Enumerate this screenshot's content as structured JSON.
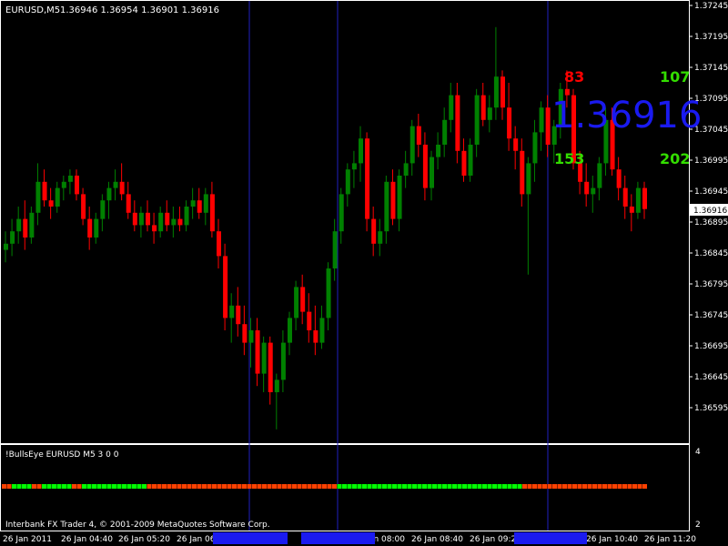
{
  "chart_data": {
    "type": "candlestick",
    "symbol_label": "EURUSD,M5",
    "ohlc_label": "1.36946 1.36954 1.36901 1.36916",
    "current_price": "1.36916",
    "big_price": "1.36916",
    "counters": {
      "top_red": "83",
      "top_green": "107",
      "bottom_left_green": "153",
      "bottom_right_green": "202"
    },
    "y_ticks": [
      "1.37245",
      "1.37195",
      "1.37145",
      "1.37095",
      "1.37045",
      "1.36995",
      "1.36945",
      "1.36895",
      "1.36845",
      "1.36795",
      "1.36745",
      "1.36695",
      "1.36645",
      "1.36595"
    ],
    "ylim": [
      1.3657,
      1.3726
    ],
    "x_ticks": [
      "26 Jan 2011",
      "26 Jan 04:40",
      "26 Jan 05:20",
      "26 Jan 06",
      "26 Jan 08:00",
      "26 Jan 08:40",
      "26 Jan 09:2",
      "26 Jan 10:40",
      "26 Jan 11:20"
    ],
    "candles": [
      {
        "o": 1.3685,
        "h": 1.3688,
        "l": 1.3683,
        "c": 1.3686
      },
      {
        "o": 1.3686,
        "h": 1.369,
        "l": 1.3684,
        "c": 1.3688
      },
      {
        "o": 1.3688,
        "h": 1.3692,
        "l": 1.3686,
        "c": 1.369
      },
      {
        "o": 1.369,
        "h": 1.3693,
        "l": 1.3685,
        "c": 1.3687
      },
      {
        "o": 1.3687,
        "h": 1.3692,
        "l": 1.3686,
        "c": 1.3691
      },
      {
        "o": 1.3691,
        "h": 1.3699,
        "l": 1.3689,
        "c": 1.3696
      },
      {
        "o": 1.3696,
        "h": 1.3698,
        "l": 1.3692,
        "c": 1.3693
      },
      {
        "o": 1.3693,
        "h": 1.3695,
        "l": 1.369,
        "c": 1.3692
      },
      {
        "o": 1.3692,
        "h": 1.3696,
        "l": 1.3691,
        "c": 1.3695
      },
      {
        "o": 1.3695,
        "h": 1.3697,
        "l": 1.3693,
        "c": 1.3696
      },
      {
        "o": 1.3696,
        "h": 1.3698,
        "l": 1.3694,
        "c": 1.3697
      },
      {
        "o": 1.3697,
        "h": 1.3698,
        "l": 1.3693,
        "c": 1.3694
      },
      {
        "o": 1.3694,
        "h": 1.3695,
        "l": 1.3689,
        "c": 1.369
      },
      {
        "o": 1.369,
        "h": 1.3692,
        "l": 1.3685,
        "c": 1.3687
      },
      {
        "o": 1.3687,
        "h": 1.3691,
        "l": 1.3686,
        "c": 1.369
      },
      {
        "o": 1.369,
        "h": 1.3694,
        "l": 1.3688,
        "c": 1.3693
      },
      {
        "o": 1.3693,
        "h": 1.3696,
        "l": 1.369,
        "c": 1.3695
      },
      {
        "o": 1.3695,
        "h": 1.3698,
        "l": 1.3693,
        "c": 1.3696
      },
      {
        "o": 1.3696,
        "h": 1.3699,
        "l": 1.3693,
        "c": 1.3694
      },
      {
        "o": 1.3694,
        "h": 1.3696,
        "l": 1.369,
        "c": 1.3691
      },
      {
        "o": 1.3691,
        "h": 1.3693,
        "l": 1.3688,
        "c": 1.3689
      },
      {
        "o": 1.3689,
        "h": 1.3692,
        "l": 1.3687,
        "c": 1.3691
      },
      {
        "o": 1.3691,
        "h": 1.3693,
        "l": 1.3688,
        "c": 1.3689
      },
      {
        "o": 1.3689,
        "h": 1.3691,
        "l": 1.3686,
        "c": 1.3688
      },
      {
        "o": 1.3688,
        "h": 1.3692,
        "l": 1.3687,
        "c": 1.3691
      },
      {
        "o": 1.3691,
        "h": 1.3693,
        "l": 1.3688,
        "c": 1.3689
      },
      {
        "o": 1.3689,
        "h": 1.3692,
        "l": 1.3687,
        "c": 1.369
      },
      {
        "o": 1.369,
        "h": 1.3692,
        "l": 1.3688,
        "c": 1.3689
      },
      {
        "o": 1.3689,
        "h": 1.3693,
        "l": 1.3688,
        "c": 1.3692
      },
      {
        "o": 1.3692,
        "h": 1.3695,
        "l": 1.369,
        "c": 1.3693
      },
      {
        "o": 1.3693,
        "h": 1.3695,
        "l": 1.369,
        "c": 1.3691
      },
      {
        "o": 1.3691,
        "h": 1.3695,
        "l": 1.3689,
        "c": 1.3694
      },
      {
        "o": 1.3694,
        "h": 1.3696,
        "l": 1.3687,
        "c": 1.3688
      },
      {
        "o": 1.3688,
        "h": 1.369,
        "l": 1.3682,
        "c": 1.3684
      },
      {
        "o": 1.3684,
        "h": 1.3686,
        "l": 1.3672,
        "c": 1.3674
      },
      {
        "o": 1.3674,
        "h": 1.3678,
        "l": 1.367,
        "c": 1.3676
      },
      {
        "o": 1.3676,
        "h": 1.3679,
        "l": 1.3671,
        "c": 1.3673
      },
      {
        "o": 1.3673,
        "h": 1.3676,
        "l": 1.3668,
        "c": 1.367
      },
      {
        "o": 1.367,
        "h": 1.3674,
        "l": 1.3666,
        "c": 1.3672
      },
      {
        "o": 1.3672,
        "h": 1.3674,
        "l": 1.3663,
        "c": 1.3665
      },
      {
        "o": 1.3665,
        "h": 1.3671,
        "l": 1.3662,
        "c": 1.367
      },
      {
        "o": 1.367,
        "h": 1.3671,
        "l": 1.366,
        "c": 1.3662
      },
      {
        "o": 1.3662,
        "h": 1.3665,
        "l": 1.3656,
        "c": 1.3664
      },
      {
        "o": 1.3664,
        "h": 1.3672,
        "l": 1.3662,
        "c": 1.367
      },
      {
        "o": 1.367,
        "h": 1.3675,
        "l": 1.3668,
        "c": 1.3674
      },
      {
        "o": 1.3674,
        "h": 1.368,
        "l": 1.3672,
        "c": 1.3679
      },
      {
        "o": 1.3679,
        "h": 1.3681,
        "l": 1.3673,
        "c": 1.3675
      },
      {
        "o": 1.3675,
        "h": 1.3678,
        "l": 1.367,
        "c": 1.3672
      },
      {
        "o": 1.3672,
        "h": 1.3676,
        "l": 1.3668,
        "c": 1.367
      },
      {
        "o": 1.367,
        "h": 1.3676,
        "l": 1.3669,
        "c": 1.3674
      },
      {
        "o": 1.3674,
        "h": 1.3683,
        "l": 1.3672,
        "c": 1.3682
      },
      {
        "o": 1.3682,
        "h": 1.369,
        "l": 1.368,
        "c": 1.3688
      },
      {
        "o": 1.3688,
        "h": 1.3695,
        "l": 1.3686,
        "c": 1.3694
      },
      {
        "o": 1.3694,
        "h": 1.3699,
        "l": 1.3692,
        "c": 1.3698
      },
      {
        "o": 1.3698,
        "h": 1.3701,
        "l": 1.3695,
        "c": 1.3699
      },
      {
        "o": 1.3699,
        "h": 1.3705,
        "l": 1.3696,
        "c": 1.3703
      },
      {
        "o": 1.3703,
        "h": 1.3704,
        "l": 1.3688,
        "c": 1.369
      },
      {
        "o": 1.369,
        "h": 1.3692,
        "l": 1.3684,
        "c": 1.3686
      },
      {
        "o": 1.3686,
        "h": 1.369,
        "l": 1.3684,
        "c": 1.3688
      },
      {
        "o": 1.3688,
        "h": 1.3697,
        "l": 1.3686,
        "c": 1.3696
      },
      {
        "o": 1.3696,
        "h": 1.3698,
        "l": 1.3689,
        "c": 1.369
      },
      {
        "o": 1.369,
        "h": 1.3698,
        "l": 1.3688,
        "c": 1.3697
      },
      {
        "o": 1.3697,
        "h": 1.3701,
        "l": 1.3695,
        "c": 1.3699
      },
      {
        "o": 1.3699,
        "h": 1.3706,
        "l": 1.3697,
        "c": 1.3705
      },
      {
        "o": 1.3705,
        "h": 1.3707,
        "l": 1.37,
        "c": 1.3702
      },
      {
        "o": 1.3702,
        "h": 1.3704,
        "l": 1.3693,
        "c": 1.3695
      },
      {
        "o": 1.3695,
        "h": 1.3701,
        "l": 1.3693,
        "c": 1.37
      },
      {
        "o": 1.37,
        "h": 1.3704,
        "l": 1.3698,
        "c": 1.3702
      },
      {
        "o": 1.3702,
        "h": 1.3708,
        "l": 1.37,
        "c": 1.3706
      },
      {
        "o": 1.3706,
        "h": 1.3712,
        "l": 1.3704,
        "c": 1.371
      },
      {
        "o": 1.371,
        "h": 1.3712,
        "l": 1.3699,
        "c": 1.3701
      },
      {
        "o": 1.3701,
        "h": 1.3703,
        "l": 1.3696,
        "c": 1.3697
      },
      {
        "o": 1.3697,
        "h": 1.3703,
        "l": 1.3696,
        "c": 1.3702
      },
      {
        "o": 1.3702,
        "h": 1.3711,
        "l": 1.37,
        "c": 1.371
      },
      {
        "o": 1.371,
        "h": 1.3712,
        "l": 1.3705,
        "c": 1.3706
      },
      {
        "o": 1.3706,
        "h": 1.371,
        "l": 1.3704,
        "c": 1.3708
      },
      {
        "o": 1.3708,
        "h": 1.3721,
        "l": 1.3706,
        "c": 1.3713
      },
      {
        "o": 1.3713,
        "h": 1.3714,
        "l": 1.3706,
        "c": 1.3708
      },
      {
        "o": 1.3708,
        "h": 1.3712,
        "l": 1.3701,
        "c": 1.3703
      },
      {
        "o": 1.3703,
        "h": 1.3705,
        "l": 1.3698,
        "c": 1.3701
      },
      {
        "o": 1.3701,
        "h": 1.3703,
        "l": 1.3692,
        "c": 1.3694
      },
      {
        "o": 1.3694,
        "h": 1.37,
        "l": 1.3681,
        "c": 1.3699
      },
      {
        "o": 1.3699,
        "h": 1.3706,
        "l": 1.3696,
        "c": 1.3704
      },
      {
        "o": 1.3704,
        "h": 1.3709,
        "l": 1.3701,
        "c": 1.3708
      },
      {
        "o": 1.3708,
        "h": 1.371,
        "l": 1.37,
        "c": 1.3702
      },
      {
        "o": 1.3702,
        "h": 1.3706,
        "l": 1.3699,
        "c": 1.3705
      },
      {
        "o": 1.3705,
        "h": 1.3712,
        "l": 1.3703,
        "c": 1.3711
      },
      {
        "o": 1.3711,
        "h": 1.3714,
        "l": 1.3708,
        "c": 1.371
      },
      {
        "o": 1.371,
        "h": 1.3711,
        "l": 1.3698,
        "c": 1.3699
      },
      {
        "o": 1.3699,
        "h": 1.3701,
        "l": 1.3694,
        "c": 1.3696
      },
      {
        "o": 1.3696,
        "h": 1.3699,
        "l": 1.3692,
        "c": 1.3694
      },
      {
        "o": 1.3694,
        "h": 1.3697,
        "l": 1.3691,
        "c": 1.3695
      },
      {
        "o": 1.3695,
        "h": 1.37,
        "l": 1.3693,
        "c": 1.3699
      },
      {
        "o": 1.3699,
        "h": 1.3708,
        "l": 1.3697,
        "c": 1.3706
      },
      {
        "o": 1.3706,
        "h": 1.3708,
        "l": 1.3697,
        "c": 1.3698
      },
      {
        "o": 1.3698,
        "h": 1.37,
        "l": 1.3693,
        "c": 1.3695
      },
      {
        "o": 1.3695,
        "h": 1.3697,
        "l": 1.369,
        "c": 1.3692
      },
      {
        "o": 1.3692,
        "h": 1.3694,
        "l": 1.3688,
        "c": 1.3691
      },
      {
        "o": 1.3691,
        "h": 1.3696,
        "l": 1.369,
        "c": 1.3695
      },
      {
        "o": 1.3695,
        "h": 1.3696,
        "l": 1.369,
        "c": 1.36916
      }
    ],
    "vlines": [
      274,
      371,
      602
    ],
    "colors": {
      "bull": "#008000",
      "bear": "#ff0000",
      "vline": "#2020c0",
      "big_price": "#1a1af0",
      "counter_red": "#ff0000",
      "counter_green": "#33dd00"
    }
  },
  "indicator": {
    "label": "!BullsEye EURUSD M5 3 0 0",
    "scale_top": "4",
    "scale_bottom": "2",
    "dots": "RRGGGGRRGGGGGGRRGGGGGGGGGGGGGRRRRRRRRRRRRRRRRRRRRRRRRRRRRRRRRRRRRRRGGGGGGGGGGGGGGGGGGGGGGGGGGGGGGGGGGGGGRRRRRRRRRRRRRRRRRRRRRRRRR",
    "dot_colors": {
      "G": "#00ff00",
      "R": "#ff4000"
    }
  },
  "footer": {
    "broker_text": "Interbank FX Trader 4, © 2001-2009 MetaQuotes Software Corp."
  }
}
